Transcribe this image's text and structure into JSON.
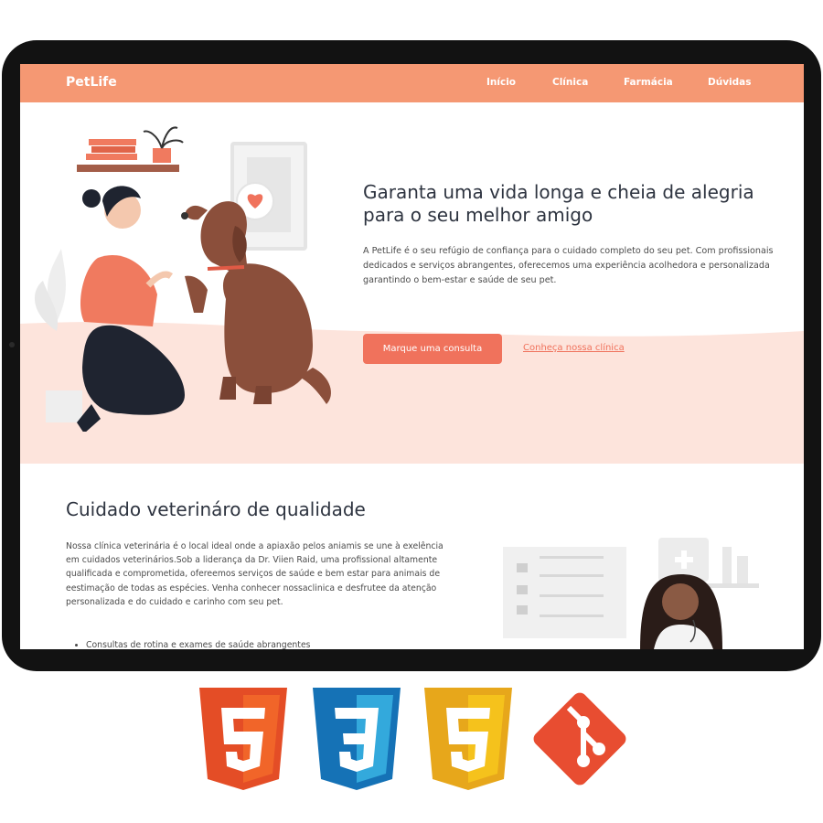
{
  "site": {
    "logo": "PetLife",
    "nav": [
      {
        "label": "Início"
      },
      {
        "label": "Clínica"
      },
      {
        "label": "Farmácia"
      },
      {
        "label": "Dúvidas"
      }
    ],
    "colors": {
      "primary": "#f59873",
      "cta": "#f0725c",
      "hero_wave": "#fde4dc"
    }
  },
  "hero": {
    "title": "Garanta uma vida longa e cheia de alegria para o seu melhor amigo",
    "text": "A PetLife é o seu refúgio de confiança para o cuidado completo do seu pet. Com profissionais dedicados e serviços abrangentes, oferecemos uma experiência acolhedora e personalizada garantindo o bem-estar e saúde de seu pet.",
    "cta_label": "Marque uma consulta",
    "link_label": "Conheça nossa clínica"
  },
  "section": {
    "title": "Cuidado veterináro de qualidade",
    "text": "Nossa clínica veterinária é o local ideal onde a apiaxão pelos aniamis se une à exelência em cuidados veterinários.Sob a liderança da Dr. Viien Raid, uma profissional altamente qualificada e comprometida, ofereemos serviços de saúde e bem estar para animais de eestimação de todas as espécies. Venha conhecer nossaclinica e desfrutee da atenção personalizada e do cuidado e carinho com seu pet.",
    "list": [
      "Consultas de rotina e exames de saúde abrangentes"
    ]
  },
  "tech_icons": [
    "html5-icon",
    "css3-icon",
    "javascript-icon",
    "git-icon"
  ]
}
